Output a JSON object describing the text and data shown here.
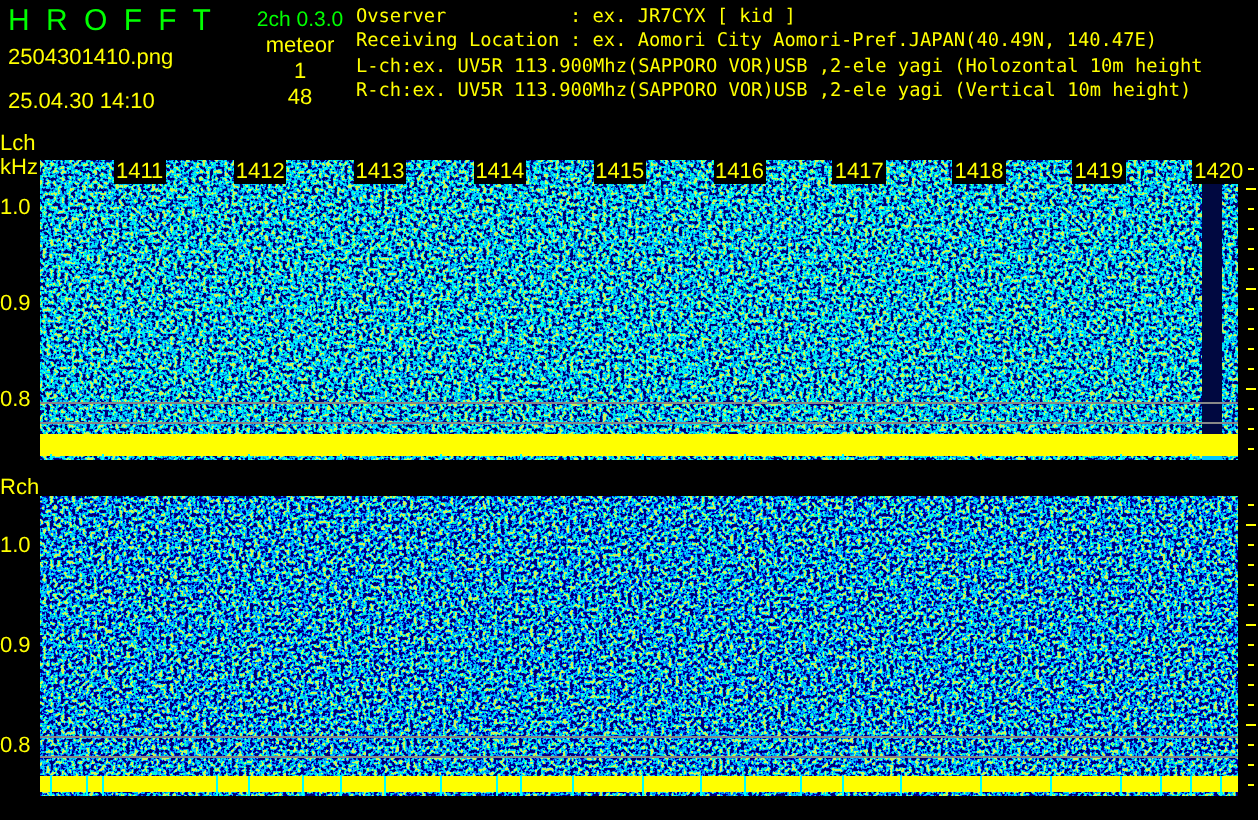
{
  "header": {
    "title": "H R O F F T",
    "version": "2ch 0.3.0",
    "file": "2504301410.png",
    "datetime": "25.04.30 14:10",
    "meteor_label": "meteor",
    "meteor_counts": [
      "1",
      "48"
    ]
  },
  "info": [
    {
      "label": "Ovserver",
      "value": ": ex. JR7CYX [ kid ]"
    },
    {
      "label": "Receiving Location",
      "value": ": ex. Aomori City Aomori-Pref.JAPAN(40.49N, 140.47E)"
    }
  ],
  "channel_lines": [
    "L-ch:ex. UV5R 113.900Mhz(SAPPORO VOR)USB ,2-ele yagi (Holozontal 10m height",
    "R-ch:ex. UV5R 113.900Mhz(SAPPORO VOR)USB ,2-ele yagi (Vertical 10m height)"
  ],
  "channels": [
    {
      "label": "Lch",
      "unit": "kHz",
      "time_labels": [
        "1411",
        "1412",
        "1413",
        "1414",
        "1415",
        "1416",
        "1417",
        "1418",
        "1419",
        "1420"
      ],
      "yticks": [
        "1.0",
        "0.9",
        "0.8"
      ]
    },
    {
      "label": "Rch",
      "yticks": [
        "1.0",
        "0.9",
        "0.8"
      ]
    }
  ]
}
